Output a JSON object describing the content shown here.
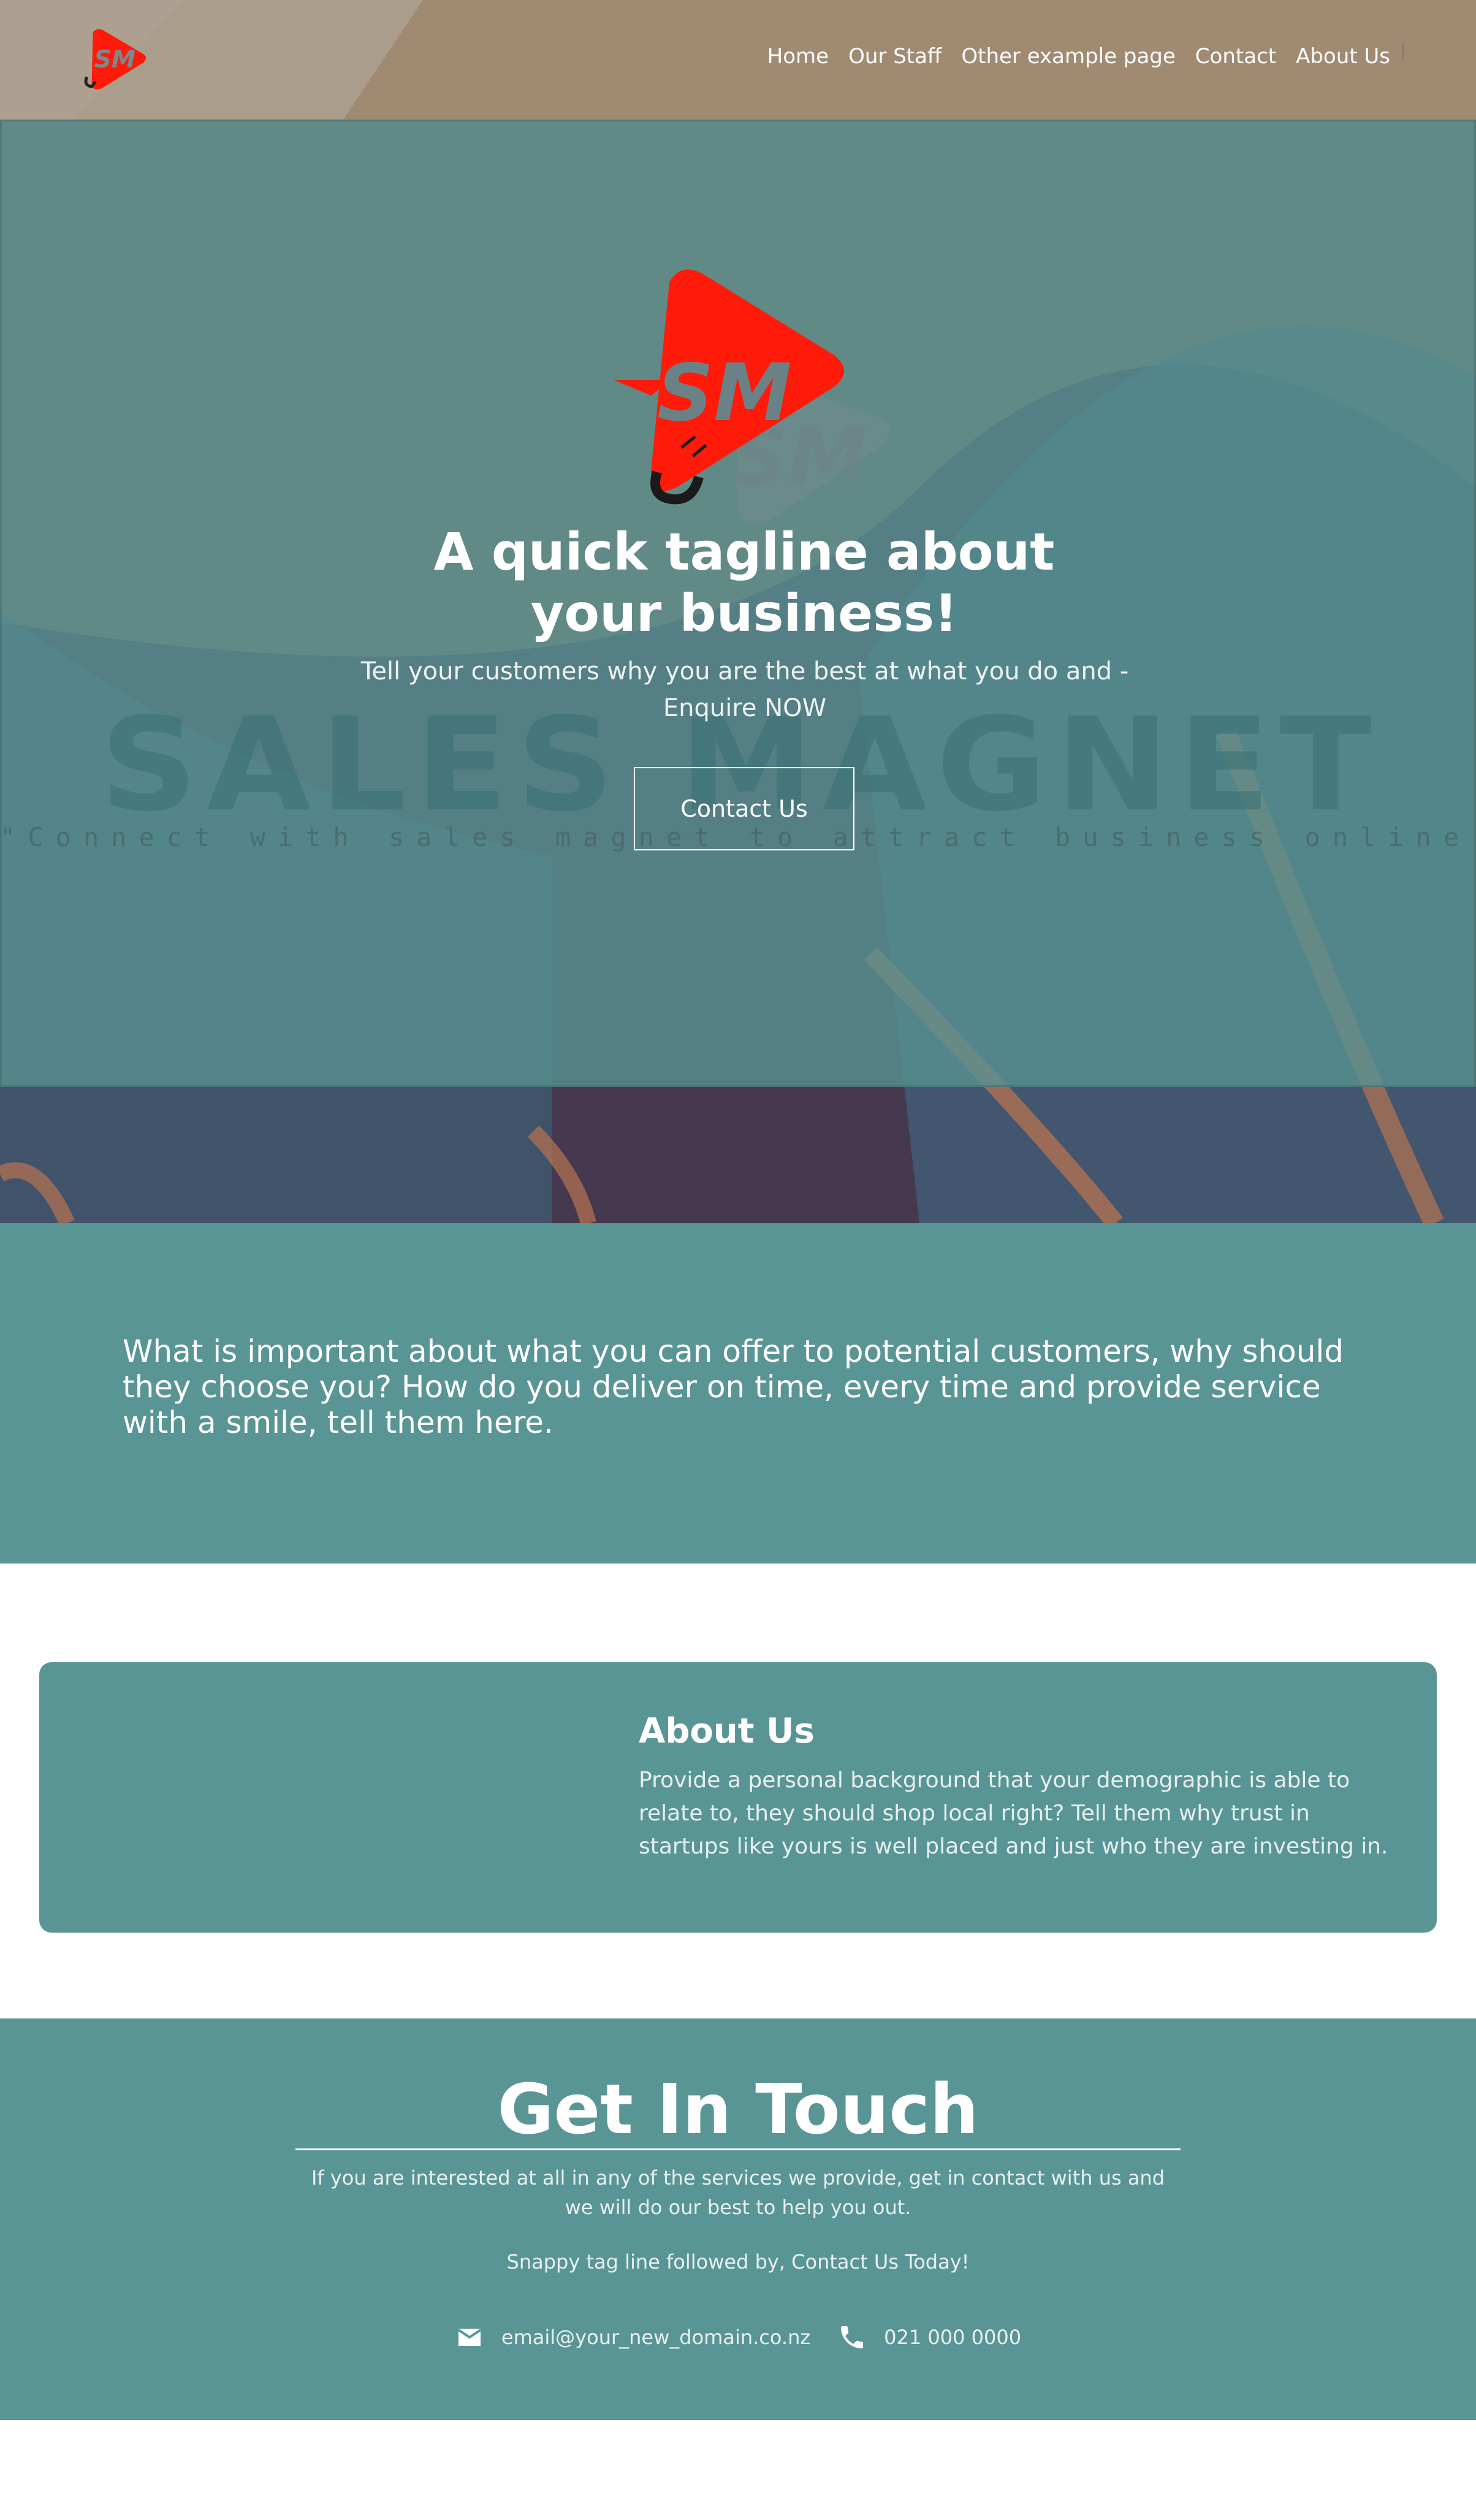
{
  "header": {
    "logo_icon": "sm-logo-icon",
    "nav": [
      {
        "label": "Home"
      },
      {
        "label": "Our Staff"
      },
      {
        "label": "Other example page"
      },
      {
        "label": "Contact"
      },
      {
        "label": "About Us"
      }
    ]
  },
  "hero": {
    "logo_icon": "sales-magnet-logo",
    "watermark": "SALES MAGNET",
    "watermark_tagline": "\"Connect with sales magnet to attract business online FAST\"",
    "title": "A quick tagline about your business!",
    "subtitle": "Tell your customers why you are the best at what you do and - Enquire NOW",
    "button_label": "Contact Us"
  },
  "intro": {
    "text": "What is important about what you can offer to potential customers, why should they choose you? How do you deliver on time, every time and provide service with a smile, tell them here."
  },
  "about": {
    "title": "About Us",
    "body": "Provide a personal background that your demographic is able to relate to, they should shop local right? Tell them why trust in startups like yours is well placed and just who they are investing in."
  },
  "contact": {
    "title": "Get In Touch",
    "text": "If you are interested at all in any of the services we provide, get in contact with us and we will do our best to help you out.",
    "tagline": "Snappy tag line followed by, Contact Us Today!",
    "email": "email@your_new_domain.co.nz",
    "phone": "021 000 0000",
    "email_icon": "mail-icon",
    "phone_icon": "phone-icon"
  },
  "colors": {
    "teal": "#5a9595",
    "logo_red": "#ff1a0a",
    "hero_purple": "#46384e",
    "header_tan": "#a08a72"
  }
}
